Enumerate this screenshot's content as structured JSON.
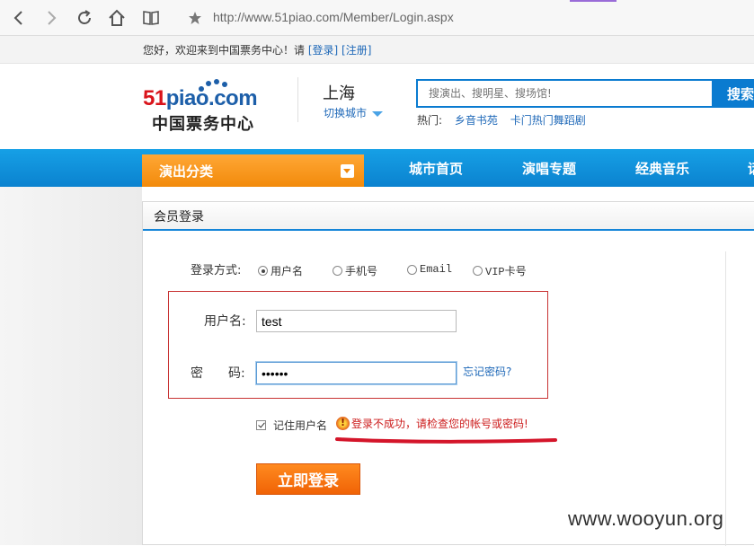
{
  "browser": {
    "url": "http://www.51piao.com/Member/Login.aspx",
    "icons": [
      "back-icon",
      "forward-icon",
      "refresh-icon",
      "home-icon",
      "reader-icon",
      "star-icon"
    ]
  },
  "welcome": {
    "text": "您好，欢迎来到中国票务中心！请",
    "login_link": "[登录]",
    "register_link": "[注册]"
  },
  "header": {
    "logo_main_red": "51",
    "logo_main_blue": "piao.com",
    "logo_sub": "中国票务中心",
    "city": "上海",
    "city_switch": "切换城市",
    "search_placeholder": "搜演出、搜明星、搜场馆!",
    "search_button": "搜索",
    "hot_label": "热门:",
    "hot_links": [
      "乡音书苑",
      "卡门热门舞蹈剧"
    ]
  },
  "nav": {
    "category": "演出分类",
    "links": [
      "城市首页",
      "演唱专题",
      "经典音乐",
      "话"
    ]
  },
  "login": {
    "panel_title": "会员登录",
    "method_label": "登录方式:",
    "methods": [
      "用户名",
      "手机号",
      "Email",
      "VIP卡号"
    ],
    "selected_method": "用户名",
    "username_label": "用户名:",
    "username_value": "test",
    "password_label": "密　　码:",
    "password_value": "••••••",
    "forgot": "忘记密码?",
    "remember_label": "记住用户名",
    "remember_checked": true,
    "error_message": "登录不成功，请检查您的帐号或密码!",
    "submit": "立即登录"
  },
  "watermark": "www.wooyun.org",
  "colors": {
    "nav_blue": "#0b82cf",
    "category_orange": "#f28a0b",
    "error_red": "#cc1b1b",
    "link_blue": "#1e68b8"
  }
}
